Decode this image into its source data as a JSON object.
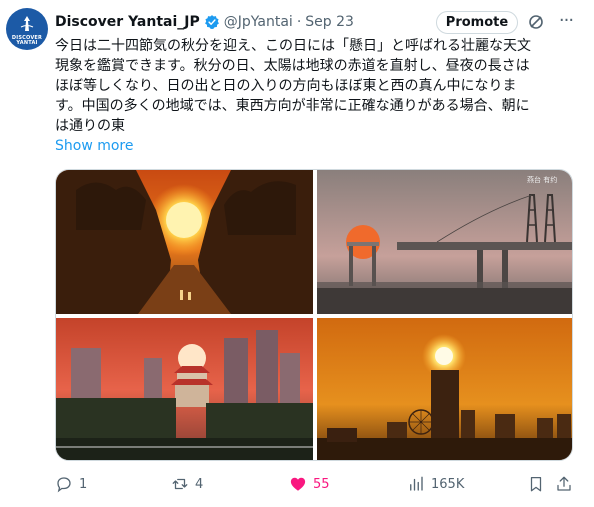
{
  "account": {
    "name": "Discover Yantai_JP",
    "handle": "@JpYantai",
    "separator": "·",
    "date": "Sep 23",
    "avatar_text": "DISCOVER\nYANTAI"
  },
  "header": {
    "promote_label": "Promote",
    "grok_icon": "grok-icon",
    "more_icon": "more-icon"
  },
  "body": {
    "lines": [
      "今日は二十四節気の秋分を迎え、この日には「懸日」と呼ばれる壮麗な天文",
      "現象を鑑賞できます。秋分の日、太陽は地球の赤道を直射し、昼夜の長さは",
      "ほぼ等しくなり、日の出と日の入りの方向もほぼ東と西の真ん中になりま",
      "す。中国の多くの地域では、東西方向が非常に正確な通りがある場合、朝に",
      "は通りの東"
    ],
    "show_more": "Show more"
  },
  "media": {
    "images": [
      {
        "name": "sunrise-street-trees"
      },
      {
        "name": "sunset-bridge-towers",
        "watermark": "燕台 有约"
      },
      {
        "name": "sunset-pagoda-skyline"
      },
      {
        "name": "sunset-tower-ferriswheel"
      }
    ]
  },
  "actions": {
    "replies": "1",
    "reposts": "4",
    "likes": "55",
    "views": "165K",
    "colors": {
      "muted": "#536471",
      "like": "#f91880",
      "link": "#1d9bf0"
    }
  }
}
